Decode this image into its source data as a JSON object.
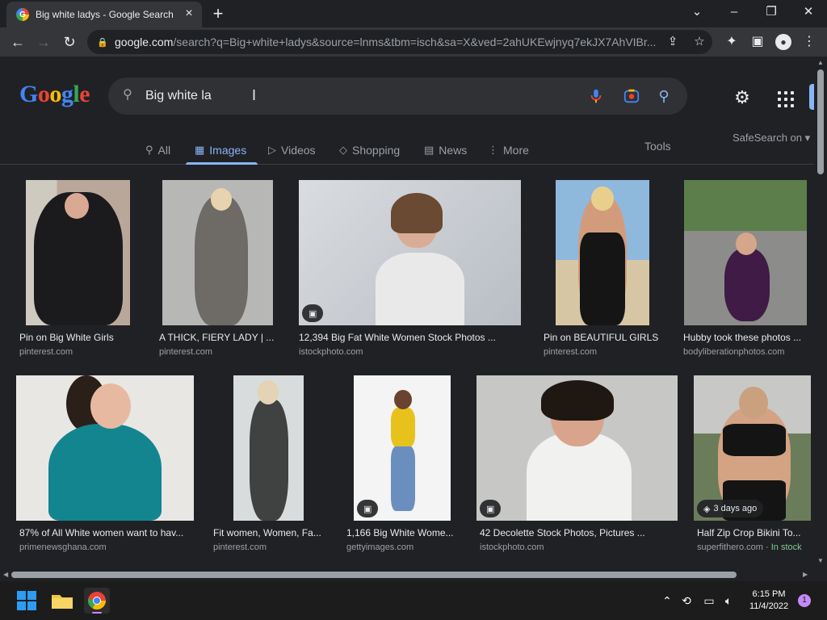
{
  "browser": {
    "tab_title": "Big white ladys - Google Search",
    "url_host": "google.com",
    "url_path": "/search?q=Big+white+ladys&source=lnms&tbm=isch&sa=X&ved=2ahUKEwjnyq7ekJX7AhVIBr...",
    "favicon_letter": "G"
  },
  "search": {
    "logo_letters": [
      "G",
      "o",
      "o",
      "g",
      "l",
      "e"
    ],
    "logo_colors": [
      "#4285f4",
      "#ea4335",
      "#fbbc05",
      "#4285f4",
      "#34a853",
      "#ea4335"
    ],
    "query": "Big white la"
  },
  "nav": {
    "tabs": [
      {
        "label": "All",
        "icon": "search-icon"
      },
      {
        "label": "Images",
        "icon": "image-icon",
        "active": true
      },
      {
        "label": "Videos",
        "icon": "play-icon"
      },
      {
        "label": "Shopping",
        "icon": "tag-icon"
      },
      {
        "label": "News",
        "icon": "news-icon"
      },
      {
        "label": "More",
        "icon": "more-vert-icon"
      }
    ],
    "tools": "Tools",
    "safesearch": "SafeSearch on"
  },
  "results": [
    {
      "caption": "Pin on Big White Girls",
      "source": "pinterest.com"
    },
    {
      "caption": "A THICK, FIERY LADY | ...",
      "source": "pinterest.com"
    },
    {
      "caption": "12,394 Big Fat White Women Stock Photos ...",
      "source": "istockphoto.com"
    },
    {
      "caption": "Pin on BEAUTIFUL GIRLS",
      "source": "pinterest.com"
    },
    {
      "caption": "Hubby took these photos ...",
      "source": "bodyliberationphotos.com"
    },
    {
      "caption": "87% of All White women want to hav...",
      "source": "primenewsghana.com"
    },
    {
      "caption": "Fit women, Women, Fa...",
      "source": "pinterest.com"
    },
    {
      "caption": "1,166 Big White Wome...",
      "source": "gettyimages.com"
    },
    {
      "caption": "42 Decolette Stock Photos, Pictures ...",
      "source": "istockphoto.com"
    },
    {
      "caption": "Half Zip Crop Bikini To...",
      "source": "superfithero.com",
      "stock": " · In stock",
      "badge": "3 days ago"
    }
  ],
  "taskbar": {
    "time": "6:15 PM",
    "date": "11/4/2022",
    "notifications": "1"
  }
}
